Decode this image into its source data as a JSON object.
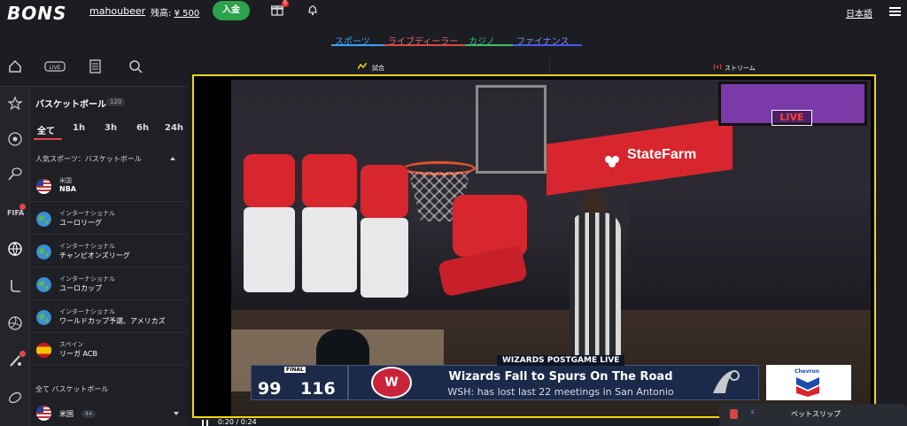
{
  "header": {
    "logo": "BONS",
    "username": "mahoubeer",
    "balance_label": "残高:",
    "balance_value": "¥ 500",
    "deposit_label": "入金",
    "gift_badge": "5",
    "language": "日本語"
  },
  "category_tabs": [
    {
      "label": "スポーツ",
      "color": "#3ea0ff"
    },
    {
      "label": "ライブディーラー",
      "color": "#e0484a"
    },
    {
      "label": "カジノ",
      "color": "#3ec06a"
    },
    {
      "label": "ファイナンス",
      "color": "#4a5be8"
    }
  ],
  "rail": {
    "icons": [
      "home-icon",
      "live-icon",
      "betslip-history-icon",
      "search-icon",
      "collapse-arrow-icon"
    ],
    "live_label": "LIVE",
    "sports": [
      "star-icon",
      "soccer-icon",
      "tennis-icon",
      "fifa-icon",
      "basketball-icon",
      "hockey-icon",
      "volleyball-icon",
      "cricket-icon",
      "rugby-icon"
    ]
  },
  "panel": {
    "title": "バスケットボール",
    "count": "120",
    "filters": [
      "全て",
      "1h",
      "3h",
      "6h",
      "24h"
    ],
    "section_popular": "人気スポーツ：バスケットボール",
    "leagues": [
      {
        "region": "米国",
        "league": "NBA",
        "flag": "us"
      },
      {
        "region": "インターナショナル",
        "league": "ユーロリーグ",
        "flag": "world"
      },
      {
        "region": "インターナショナル",
        "league": "チャンピオンズリーグ",
        "flag": "world"
      },
      {
        "region": "インターナショナル",
        "league": "ユーロカップ",
        "flag": "world"
      },
      {
        "region": "インターナショナル",
        "league": "ワールドカップ予選、アメリカズ",
        "flag": "world"
      },
      {
        "region": "スペイン",
        "league": "リーガ ACB",
        "flag": "es"
      }
    ],
    "section_all": "全て バスケットボール",
    "country": {
      "name": "米国",
      "count": "44"
    }
  },
  "main": {
    "tab_match": "試合",
    "tab_stream": "ストリーム"
  },
  "video": {
    "live_badge": "LIVE",
    "banner": "StateFarm",
    "final_label": "FINAL",
    "score_home": "99",
    "score_away": "116",
    "lower_third_header": "WIZARDS POSTGAME LIVE",
    "headline": "Wizards Fall to Spurs On The Road",
    "subline": "WSH: has lost last 22 meetings in San Antonio",
    "sponsor": "Chevron",
    "time": "0:20 / 0:24"
  },
  "betslip": {
    "label": "ベットスリップ"
  },
  "colors": {
    "accent_red": "#e0484a",
    "deposit_green": "#2ca24b",
    "frame_yellow": "#f0d61a"
  }
}
